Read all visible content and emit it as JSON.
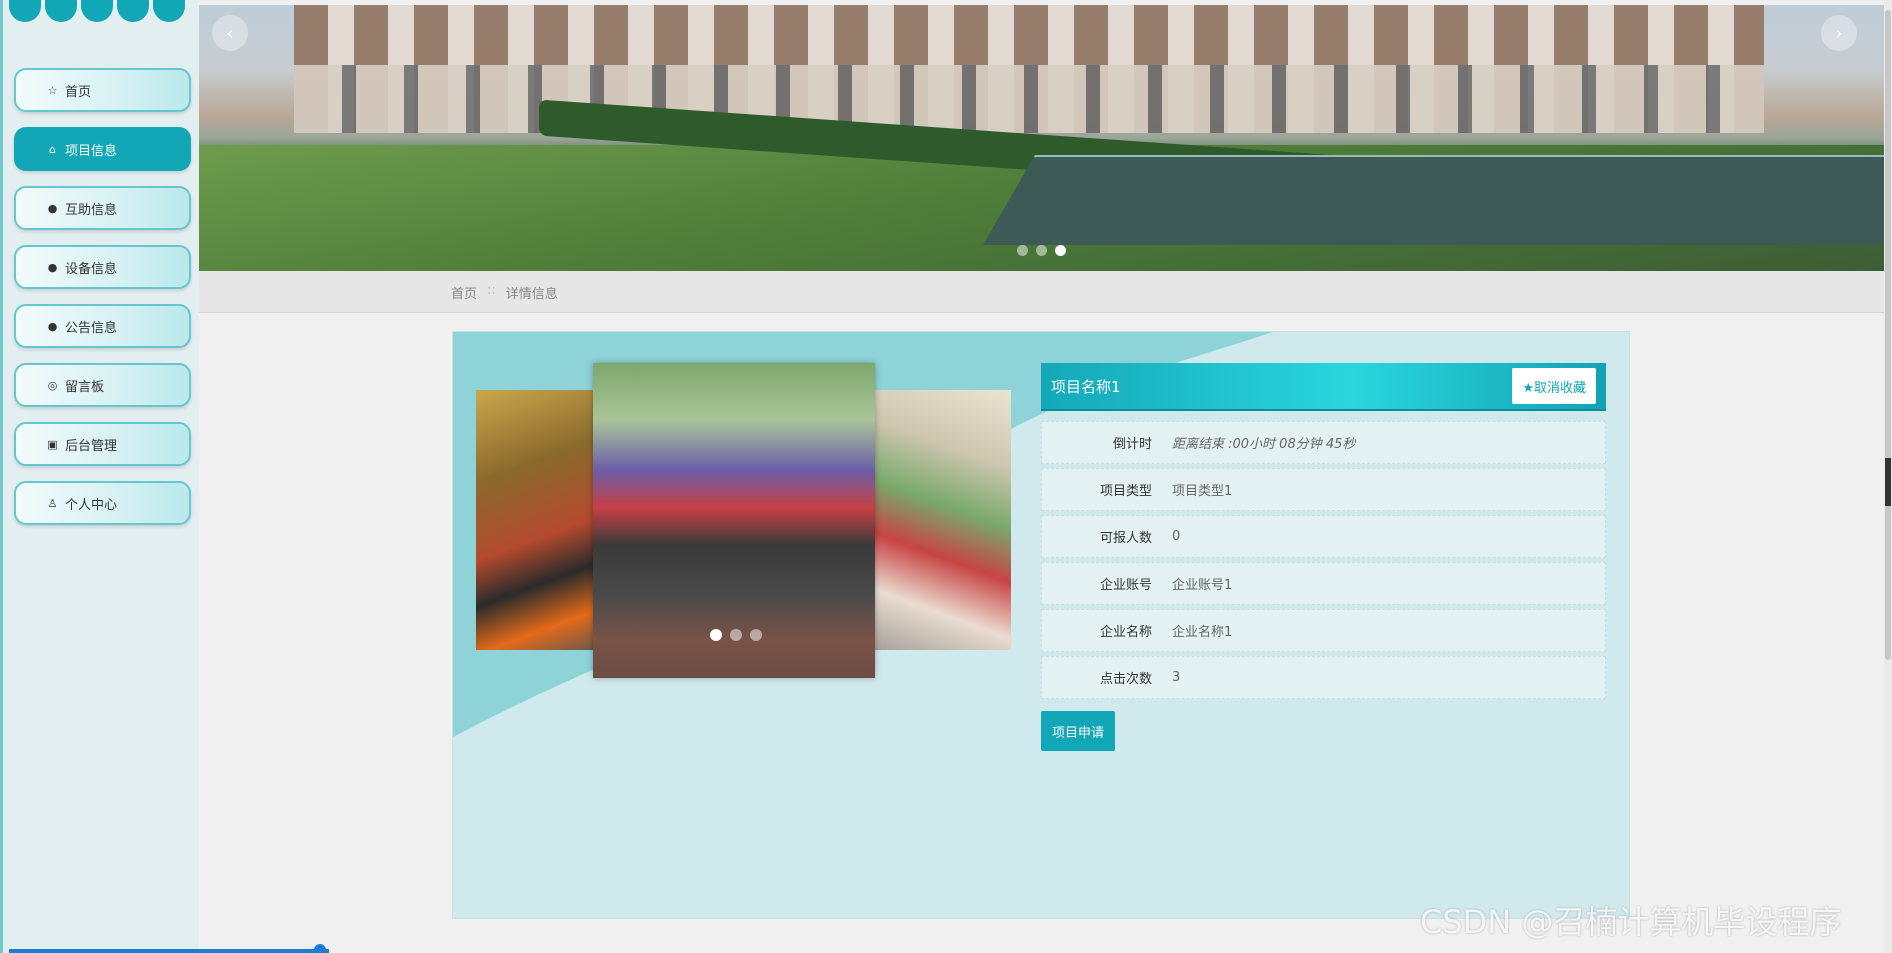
{
  "sidebar": {
    "items": [
      {
        "label": "首页",
        "icon": "star-icon",
        "glyph": "☆"
      },
      {
        "label": "项目信息",
        "icon": "bag-icon",
        "glyph": "⌂"
      },
      {
        "label": "互助信息",
        "icon": "info-circle-icon",
        "glyph": "●"
      },
      {
        "label": "设备信息",
        "icon": "question-circle-icon",
        "glyph": "●"
      },
      {
        "label": "公告信息",
        "icon": "info-circle-icon",
        "glyph": "●"
      },
      {
        "label": "留言板",
        "icon": "chat-icon",
        "glyph": "◎"
      },
      {
        "label": "后台管理",
        "icon": "calendar-icon",
        "glyph": "▣"
      },
      {
        "label": "个人中心",
        "icon": "user-icon",
        "glyph": "♙"
      }
    ],
    "active_index": 1
  },
  "banner": {
    "prev_glyph": "‹",
    "next_glyph": "›",
    "active_dot": 2
  },
  "breadcrumb": {
    "home": "首页",
    "separator": "::",
    "current": "详情信息"
  },
  "gallery": {
    "active_dot": 0
  },
  "detail": {
    "title": "项目名称1",
    "favorite_label": "★取消收藏",
    "fields": [
      {
        "label": "倒计时",
        "value": "距离结束 :00小时 08分钟 45秒",
        "italic": true
      },
      {
        "label": "项目类型",
        "value": "项目类型1"
      },
      {
        "label": "可报人数",
        "value": "0"
      },
      {
        "label": "企业账号",
        "value": "企业账号1"
      },
      {
        "label": "企业名称",
        "value": "企业名称1"
      },
      {
        "label": "点击次数",
        "value": "3"
      }
    ],
    "apply_label": "项目申请"
  },
  "watermark": "CSDN @召楠计算机毕设程序",
  "colors": {
    "accent": "#12a7b6",
    "card_bg": "#d0e9ec",
    "wave": "#8dd0d6"
  }
}
